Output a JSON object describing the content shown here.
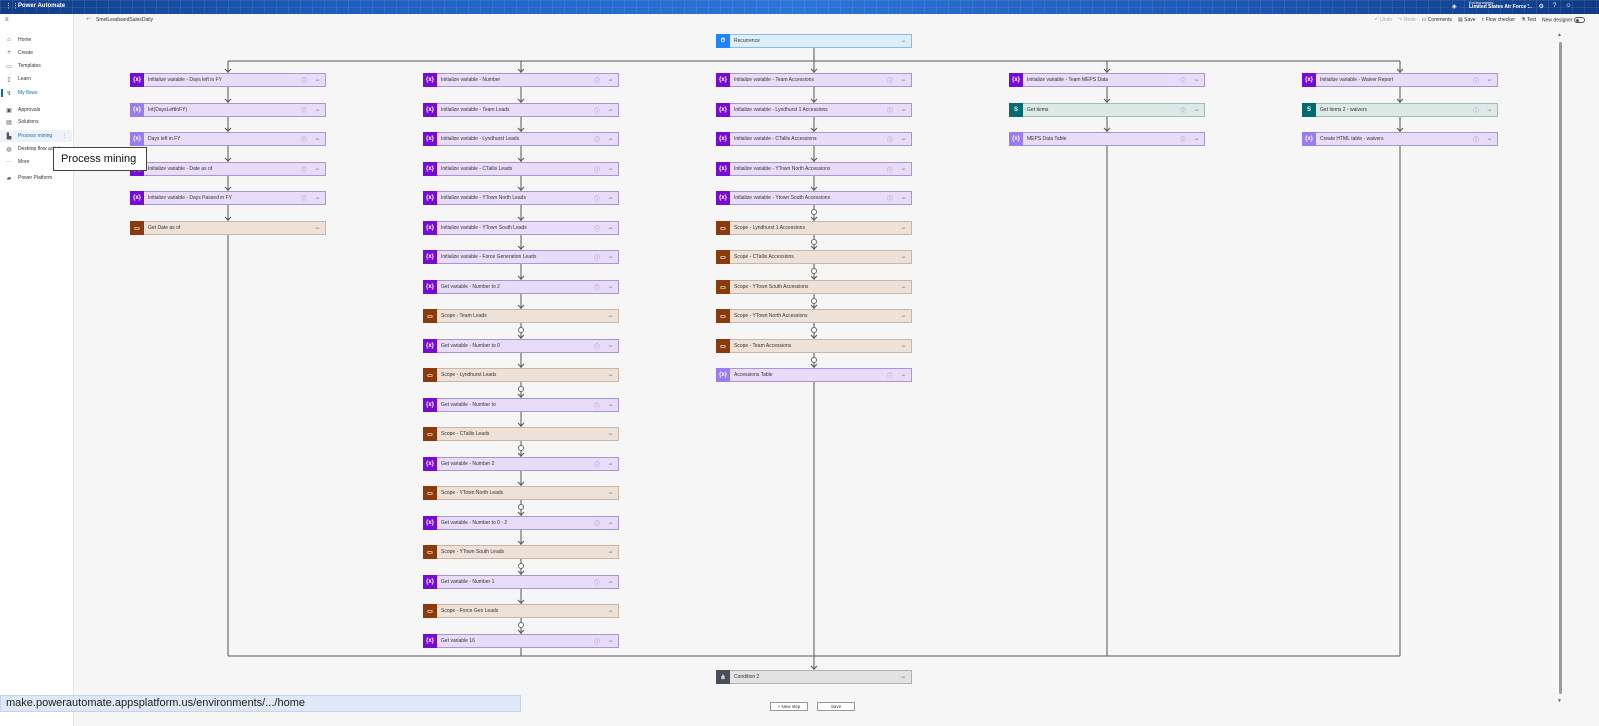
{
  "app": {
    "name": "Power Automate"
  },
  "environment": {
    "label": "Environments",
    "name": "Limited States Air Force ..."
  },
  "sidebar": {
    "items": [
      {
        "label": "Home",
        "icon": "home-icon",
        "glyph": "⌂"
      },
      {
        "label": "Create",
        "icon": "plus-icon",
        "glyph": "+"
      },
      {
        "label": "Templates",
        "icon": "templates-icon",
        "glyph": "▭"
      },
      {
        "label": "Learn",
        "icon": "book-icon",
        "glyph": "▯"
      },
      {
        "label": "My flows",
        "icon": "flows-icon",
        "glyph": "↯"
      },
      {
        "label": "Approvals",
        "icon": "approvals-icon",
        "glyph": "▣"
      },
      {
        "label": "Solutions",
        "icon": "solutions-icon",
        "glyph": "▤"
      },
      {
        "label": "Process mining",
        "icon": "process-mining-icon",
        "glyph": "▙"
      },
      {
        "label": "Desktop flow activity",
        "icon": "desktop-flow-icon",
        "glyph": "◍"
      },
      {
        "label": "More",
        "icon": "more-icon",
        "glyph": "···"
      },
      {
        "label": "Power Platform",
        "icon": "power-platform-icon",
        "glyph": "▰"
      }
    ]
  },
  "tooltip": "Process mining",
  "flow": {
    "name": "SmelLeadsandSalesDaily"
  },
  "commands": {
    "undo": "Undo",
    "redo": "Redo",
    "comments": "Comments",
    "save": "Save",
    "flow_checker": "Flow checker",
    "test": "Test",
    "new_designer": "New designer"
  },
  "trigger": {
    "label": "Recurrence"
  },
  "branches": [
    {
      "cards": [
        {
          "label": "Initialize variable - Days left in FY",
          "kind": "var",
          "info": true
        },
        {
          "label": "Int(DaysLeftInFY)",
          "kind": "varl",
          "info": true
        },
        {
          "label": "Days left in FY",
          "kind": "varl",
          "info": true
        },
        {
          "label": "Initialize variable - Date as of",
          "kind": "var",
          "info": true
        },
        {
          "label": "Initialize variable - Days Passed in FY",
          "kind": "var",
          "info": true
        },
        {
          "label": "Get Date as of",
          "kind": "scope",
          "info": false
        }
      ]
    },
    {
      "cards": [
        {
          "label": "Initialize variable - Number",
          "kind": "var",
          "info": true
        },
        {
          "label": "Initialize variable - Team Leads",
          "kind": "var",
          "info": true
        },
        {
          "label": "Initialize variable - Lyndhurst Leads",
          "kind": "var",
          "info": true
        },
        {
          "label": "Initialize variable - CTallis Leads",
          "kind": "var",
          "info": true
        },
        {
          "label": "Initialize variable - YTown North Leads",
          "kind": "var",
          "info": true
        },
        {
          "label": "Initialize variable - YTown South Leads",
          "kind": "var",
          "info": true
        },
        {
          "label": "Initialize variable - Force Generation Leads",
          "kind": "var",
          "info": true
        },
        {
          "label": "Get variable - Number to 2",
          "kind": "var",
          "info": true
        },
        {
          "label": "Scope - Team Leads",
          "kind": "scope",
          "info": false
        },
        {
          "label": "Get variable - Number to 0",
          "kind": "var",
          "info": true
        },
        {
          "label": "Scope - Lyndhurst Leads",
          "kind": "scope",
          "info": false
        },
        {
          "label": "Get variable - Number to",
          "kind": "var",
          "info": true
        },
        {
          "label": "Scope - CTallis Leads",
          "kind": "scope",
          "info": false
        },
        {
          "label": "Get variable - Number 2",
          "kind": "var",
          "info": true
        },
        {
          "label": "Scope - YTown North Leads",
          "kind": "scope",
          "info": false
        },
        {
          "label": "Get variable - Number to 0 - 2",
          "kind": "var",
          "info": true
        },
        {
          "label": "Scope - YTown South Leads",
          "kind": "scope",
          "info": false
        },
        {
          "label": "Get variable - Number 1",
          "kind": "var",
          "info": true
        },
        {
          "label": "Scope - Force Gen Leads",
          "kind": "scope",
          "info": false
        },
        {
          "label": "Get variable 16",
          "kind": "var",
          "info": true
        }
      ]
    },
    {
      "cards": [
        {
          "label": "Initialize variable - Team Accessions",
          "kind": "var",
          "info": true
        },
        {
          "label": "Initialize variable - Lyndhurst 1 Accessions",
          "kind": "var",
          "info": true
        },
        {
          "label": "Initialize variable - CTallis Accessions",
          "kind": "var",
          "info": true
        },
        {
          "label": "Initialize variable - YTown North Accessions",
          "kind": "var",
          "info": true
        },
        {
          "label": "Initialize variable - Ytown South Accessions",
          "kind": "var",
          "info": true
        },
        {
          "label": "Scope - Lyndhurst 1 Accessions",
          "kind": "scope",
          "info": false
        },
        {
          "label": "Scope - CTallis Accessions",
          "kind": "scope",
          "info": false
        },
        {
          "label": "Scope - YTown South Accessions",
          "kind": "scope",
          "info": false
        },
        {
          "label": "Scope - YTown North Accessions",
          "kind": "scope",
          "info": false
        },
        {
          "label": "Scope - Team Accessions",
          "kind": "scope",
          "info": false
        },
        {
          "label": "Accessions Table",
          "kind": "varl",
          "info": true
        }
      ]
    },
    {
      "cards": [
        {
          "label": "Initialize variable - Team MEPS Data",
          "kind": "var",
          "info": true
        },
        {
          "label": "Get items",
          "kind": "sp",
          "info": true
        },
        {
          "label": "MEPS Data Table",
          "kind": "varl",
          "info": true
        }
      ]
    },
    {
      "cards": [
        {
          "label": "Initialize variable - Waiver Report",
          "kind": "var",
          "info": true
        },
        {
          "label": "Get items 2 - waivers",
          "kind": "sp",
          "info": true
        },
        {
          "label": "Create HTML table - waivers",
          "kind": "varl",
          "info": true
        }
      ]
    }
  ],
  "condition": {
    "label": "Condition 2"
  },
  "footer": {
    "new_step": "+ New step",
    "save": "Save"
  },
  "status_url": "make.powerautomate.appsplatform.us/environments/.../home"
}
